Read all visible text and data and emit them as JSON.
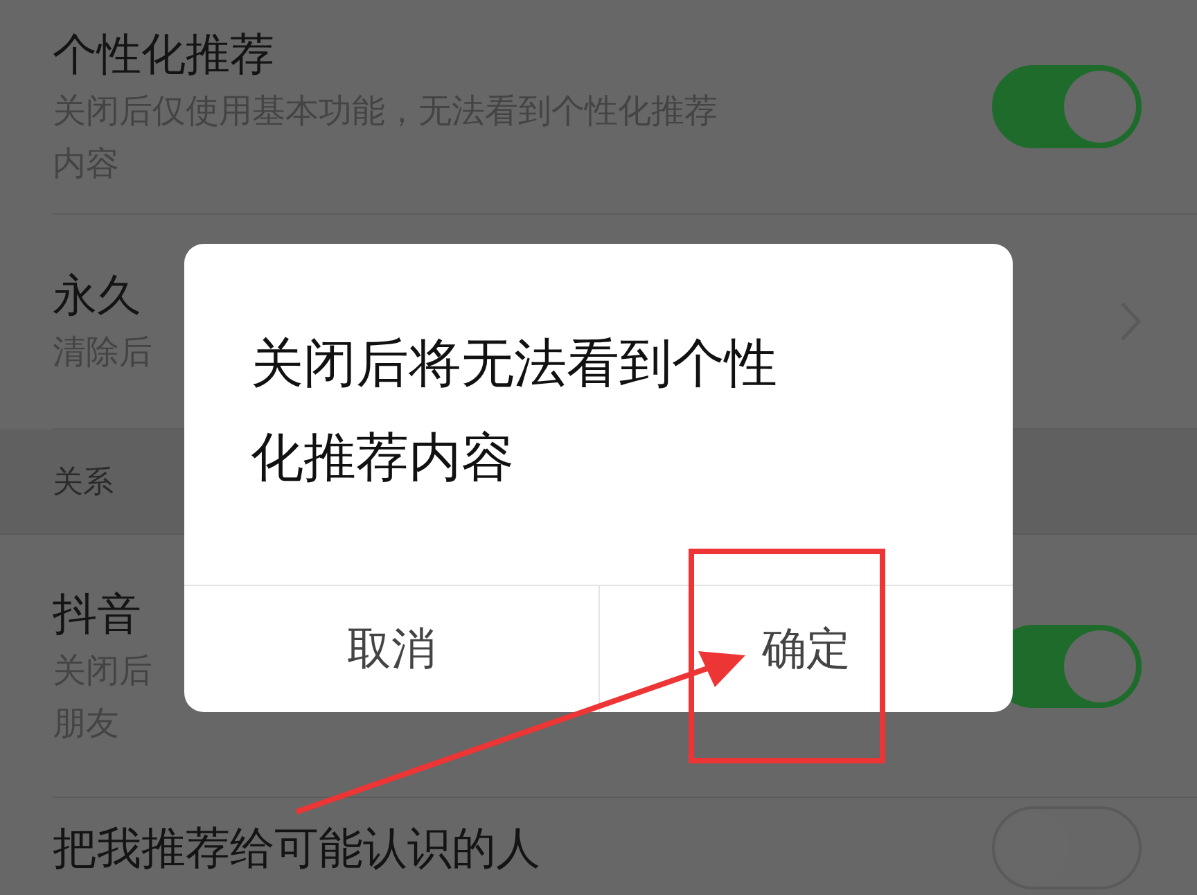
{
  "settings": [
    {
      "kind": "toggle",
      "title": "个性化推荐",
      "subtitle": [
        "关闭后仅使用基本功能，无法看到个性化推荐",
        "内容"
      ],
      "on": true
    },
    {
      "kind": "link",
      "title": "永久",
      "subtitle": [
        "清除后"
      ]
    },
    {
      "kind": "section",
      "title": "关系"
    },
    {
      "kind": "toggle",
      "title": "抖音",
      "subtitle": [
        "关闭后",
        "朋友"
      ],
      "on": true
    },
    {
      "kind": "toggle",
      "title": "把我推荐给可能认识的人",
      "on": false
    }
  ],
  "dialog": {
    "message": [
      "关闭后将无法看到个性",
      "化推荐内容"
    ],
    "buttons": [
      {
        "label": "取消"
      },
      {
        "label": "确定"
      }
    ]
  }
}
